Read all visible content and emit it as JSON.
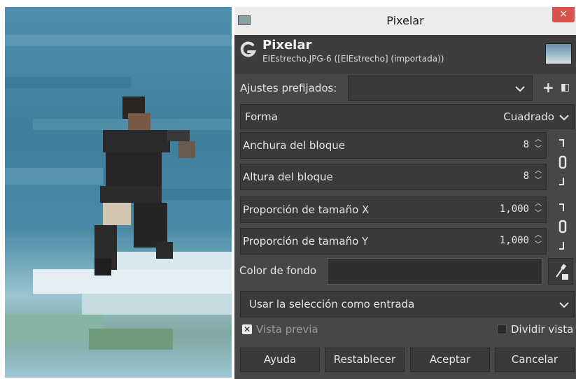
{
  "dialog": {
    "window_title": "Pixelar",
    "close_label": "×",
    "plugin_name": "Pixelar",
    "image_info": "ElEstrecho.JPG-6 ([ElEstrecho] (importada))"
  },
  "presets": {
    "label": "Ajustes prefijados:",
    "value": "",
    "add_icon": "+",
    "menu_icon": "◧"
  },
  "shape": {
    "label": "Forma",
    "value": "Cuadrado"
  },
  "block_width": {
    "label": "Anchura del bloque",
    "value": "8"
  },
  "block_height": {
    "label": "Altura del bloque",
    "value": "8"
  },
  "ratio_x": {
    "label": "Proporción de tamaño X",
    "value": "1,000"
  },
  "ratio_y": {
    "label": "Proporción de tamaño Y",
    "value": "1,000"
  },
  "background": {
    "label": "Color de fondo",
    "color": "#2f2f2f"
  },
  "input_mode": {
    "value": "Usar la selección como entrada"
  },
  "preview": {
    "label": "Vista previa",
    "checked": true
  },
  "split_view": {
    "label": "Dividir vista",
    "checked": false
  },
  "buttons": {
    "help": "Ayuda",
    "reset": "Restablecer",
    "ok": "Aceptar",
    "cancel": "Cancelar"
  },
  "colors": {
    "dialog_bg": "#474747",
    "field_bg": "#3a3a3a",
    "close_bg": "#d9534f"
  },
  "icons": [
    "gimp-logo-icon",
    "chain-link-icon",
    "color-picker-icon",
    "chevron-down-icon",
    "spin-arrows-icon",
    "checkbox-icon",
    "preview-thumbnail"
  ]
}
